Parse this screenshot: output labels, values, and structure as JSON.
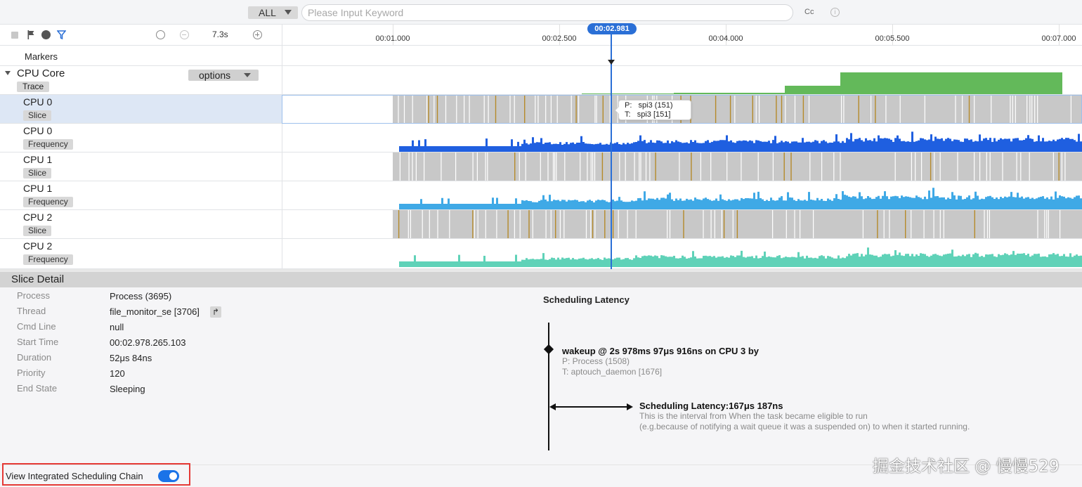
{
  "search": {
    "scope_label": "ALL",
    "placeholder": "Please Input Keyword",
    "value": "",
    "case_label": "Cc",
    "info_icon": "info-circle-icon"
  },
  "toolbar": {
    "scale": "7.3s",
    "icons": [
      "stop-square-icon",
      "flag-icon",
      "globe-icon",
      "filter-icon",
      "timer-icon",
      "zoom-out-icon",
      "zoom-in-icon"
    ]
  },
  "timeline": {
    "ticks": [
      "00:01.000",
      "00:02.500",
      "00:04.000",
      "00:05.500",
      "00:07.000"
    ],
    "cursor_label": "00:02.981"
  },
  "markers_label": "Markers",
  "group": {
    "name": "CPU Core",
    "tag": "Trace",
    "options_label": "options"
  },
  "tracks": [
    {
      "name": "CPU 0",
      "tag": "Slice"
    },
    {
      "name": "CPU 0",
      "tag": "Frequency"
    },
    {
      "name": "CPU 1",
      "tag": "Slice"
    },
    {
      "name": "CPU 1",
      "tag": "Frequency"
    },
    {
      "name": "CPU 2",
      "tag": "Slice"
    },
    {
      "name": "CPU 2",
      "tag": "Frequency"
    }
  ],
  "tooltip": {
    "process": "P:   spi3 (151)",
    "thread": "T:   spi3 [151]"
  },
  "detail": {
    "title": "Slice Detail",
    "rows": [
      {
        "key": "Process",
        "value": "Process (3695)"
      },
      {
        "key": "Thread",
        "value": "file_monitor_se [3706]"
      },
      {
        "key": "Cmd Line",
        "value": "null"
      },
      {
        "key": "Start Time",
        "value": "00:02.978.265.103"
      },
      {
        "key": "Duration",
        "value": "52μs 84ns"
      },
      {
        "key": "Priority",
        "value": "120"
      },
      {
        "key": "End State",
        "value": "Sleeping"
      }
    ]
  },
  "latency": {
    "title": "Scheduling Latency",
    "wakeup": "wakeup @ 2s 978ms 97μs 916ns on CPU 3 by",
    "process": "P: Process (1508)",
    "thread": "T: aptouch_daemon [1676]",
    "value": "Scheduling Latency:167μs 187ns",
    "desc1": "This is the interval from When the task became eligible to run",
    "desc2": "(e.g.because of notifying a wait queue it was a suspended on) to when it started running."
  },
  "footer": {
    "chain_label": "View Integrated Scheduling Chain",
    "chain_enabled": true
  },
  "watermark": "掘金技术社区 @ 慢慢529",
  "colors": {
    "accent": "#2a6fd6",
    "trace_green": "#63b95a",
    "slice_gray": "#c8c8c8",
    "slice_gold": "#b58a2a",
    "cpu0_freq": "#1f5fe0",
    "cpu1_freq": "#3fa9e6",
    "cpu2_freq": "#5fd2b8",
    "highlight_red": "#e53935"
  }
}
